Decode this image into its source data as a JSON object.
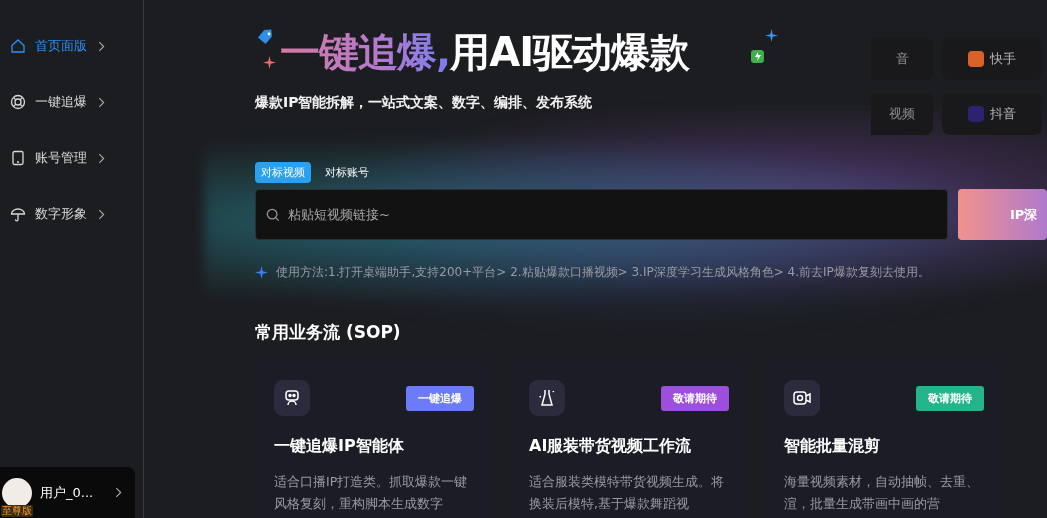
{
  "sidebar": {
    "items": [
      {
        "label": "首页面版",
        "kind": "home",
        "selected": true
      },
      {
        "label": "一键追爆",
        "kind": "lifebuoy",
        "selected": false
      },
      {
        "label": "账号管理",
        "kind": "tablet",
        "selected": false
      },
      {
        "label": "数字形象",
        "kind": "umbrella",
        "selected": false
      }
    ],
    "user": {
      "name": "用户_0...",
      "badge": "至尊版"
    }
  },
  "hero": {
    "title_highlight": "一键追爆,",
    "title_rest": "用AI驱动爆款",
    "subtitle": "爆款IP智能拆解，一站式文案、数字、编排、发布系统",
    "platforms": [
      {
        "label": "音"
      },
      {
        "label": "快手",
        "color": "#d9622b"
      },
      {
        "label": "视频"
      },
      {
        "label": "抖音",
        "color": "#2a2470"
      }
    ]
  },
  "search": {
    "tabs": [
      {
        "label": "对标视频",
        "selected": true
      },
      {
        "label": "对标账号",
        "selected": false
      }
    ],
    "placeholder": "粘贴短视频链接~",
    "button": "IP深"
  },
  "usage": "使用方法:1.打开桌端助手,支持200+平台> 2.粘贴爆款口播视频> 3.IP深度学习生成风格角色> 4.前去IP爆款复刻去使用。",
  "sop": {
    "title": "常用业务流 (SOP)",
    "cards": [
      {
        "kind": "robot",
        "tag": "一键追爆",
        "color": "#6b7cf6",
        "title": "一键追爆IP智能体",
        "desc": "适合口播IP打造类。抓取爆款一键风格复刻，重构脚本生成数字"
      },
      {
        "kind": "dress",
        "tag": "敬请期待",
        "color": "#9c4fdc",
        "title": "AI服装带货视频工作流",
        "desc": "适合服装类模特带货视频生成。将换装后模特,基于爆款舞蹈视"
      },
      {
        "kind": "camera",
        "tag": "敬请期待",
        "color": "#23b48a",
        "title": "智能批量混剪",
        "desc": "海量视频素材，自动抽帧、去重、渲，批量生成带画中画的营"
      }
    ]
  }
}
